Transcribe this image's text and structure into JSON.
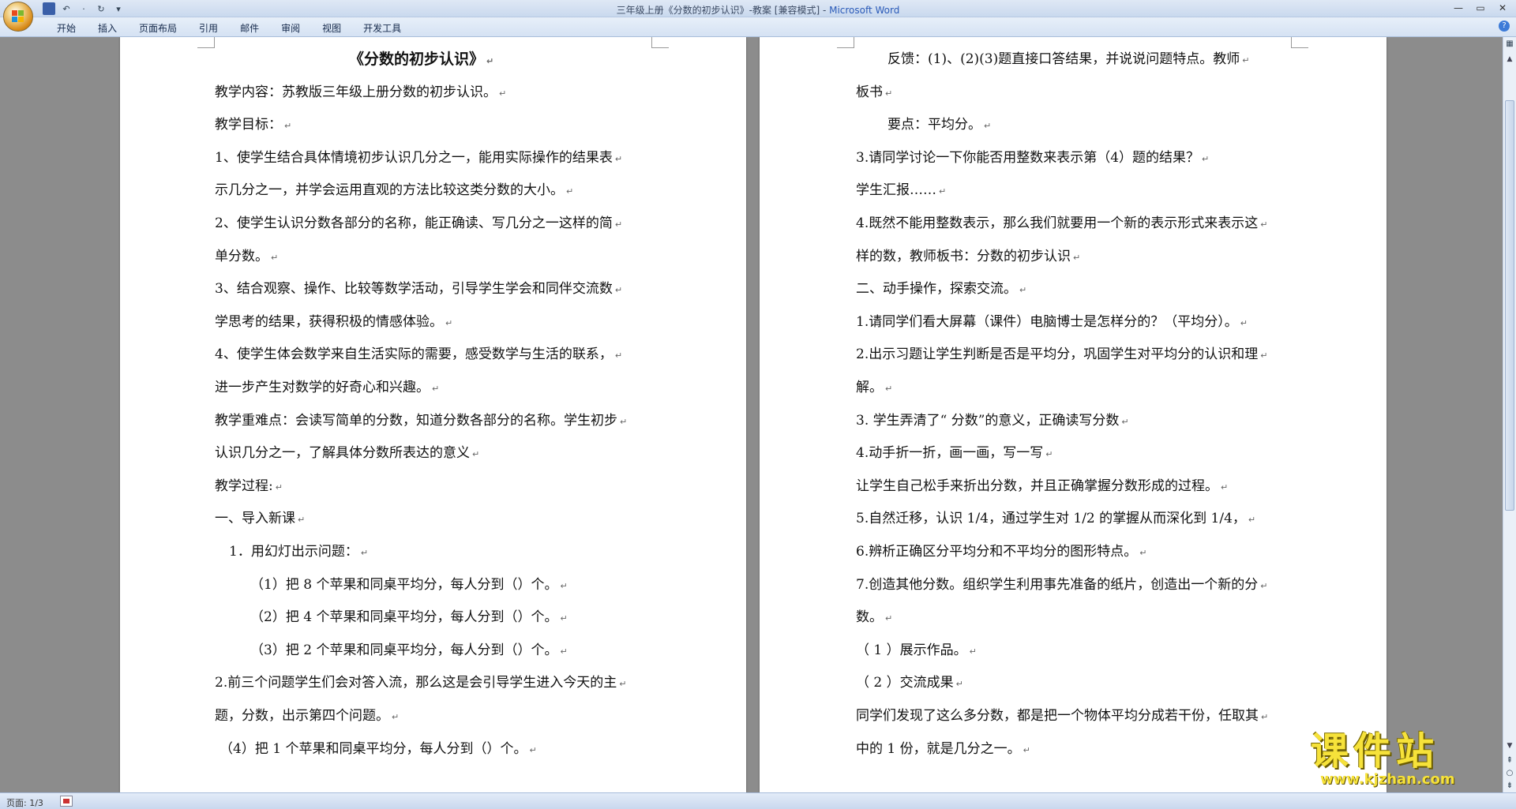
{
  "window": {
    "title": "三年级上册《分数的初步认识》-教案 [兼容模式] - ",
    "app_name": "Microsoft Word",
    "controls": [
      "—",
      "▭",
      "✕"
    ]
  },
  "quick_access": {
    "save_icon": "save-icon",
    "undo_icon": "undo-icon",
    "redo_icon": "redo-icon",
    "customize_icon": "customize-icon",
    "glyphs": [
      "💾",
      "↶",
      "·",
      "↻",
      "▾"
    ]
  },
  "ribbon": {
    "tabs": [
      "开始",
      "插入",
      "页面布局",
      "引用",
      "邮件",
      "审阅",
      "视图",
      "开发工具"
    ],
    "help": "?"
  },
  "pages": {
    "left": [
      "《分数的初步认识》",
      "教学内容：苏教版三年级上册分数的初步认识。",
      "教学目标：",
      "1、使学生结合具体情境初步认识几分之一，能用实际操作的结果表",
      "示几分之一，并学会运用直观的方法比较这类分数的大小。",
      "2、使学生认识分数各部分的名称，能正确读、写几分之一这样的简",
      "单分数。",
      "3、结合观察、操作、比较等数学活动，引导学生学会和同伴交流数",
      "学思考的结果，获得积极的情感体验。",
      "4、使学生体会数学来自生活实际的需要，感受数学与生活的联系，",
      "进一步产生对数学的好奇心和兴趣。",
      "教学重难点：会读写简单的分数，知道分数各部分的名称。学生初步",
      "认识几分之一，了解具体分数所表达的意义",
      "教学过程:",
      "一、导入新课",
      "1．用幻灯出示问题：",
      "（1）把 8 个苹果和同桌平均分，每人分到（）个。",
      "（2）把 4 个苹果和同桌平均分，每人分到（）个。",
      "（3）把 2 个苹果和同桌平均分，每人分到（）个。",
      "2.前三个问题学生们会对答入流，那么这是会引导学生进入今天的主",
      "题，分数，出示第四个问题。",
      "（4）把 1 个苹果和同桌平均分，每人分到（）个。"
    ],
    "right": [
      "反馈：(1)、(2)(3)题直接口答结果，并说说问题特点。教师",
      "板书",
      "要点：平均分。",
      "3.请同学讨论一下你能否用整数来表示第（4）题的结果？",
      "学生汇报……",
      "4.既然不能用整数表示，那么我们就要用一个新的表示形式来表示这",
      "样的数，教师板书：分数的初步认识",
      "二、动手操作，探索交流。",
      "1.请同学们看大屏幕（课件）电脑博士是怎样分的？（平均分）。",
      "2.出示习题让学生判断是否是平均分，巩固学生对平均分的认识和理",
      "解。",
      "3. 学生弄清了“ 分数”的意义，正确读写分数",
      "4.动手折一折，画一画，写一写",
      "让学生自己松手来折出分数，并且正确掌握分数形成的过程。",
      "5.自然迁移，认识 1/4，通过学生对 1/2 的掌握从而深化到 1/4，",
      "6.辨析正确区分平均分和不平均分的图形特点。",
      "7.创造其他分数。组织学生利用事先准备的纸片，创造出一个新的分",
      "数。",
      "（ 1 ）展示作品。",
      "（ 2 ）交流成果",
      "同学们发现了这么多分数，都是把一个物体平均分成若干份，任取其",
      "中的 1 份，就是几分之一。"
    ]
  },
  "status": {
    "page_info": "页面: 1/3"
  },
  "watermark": {
    "big": "课件站",
    "small": "www.kjzhan.com"
  },
  "colors": {
    "app_name": "#2a5ab8",
    "watermark": "#f6e23a",
    "office_orange": "#d88a16"
  }
}
